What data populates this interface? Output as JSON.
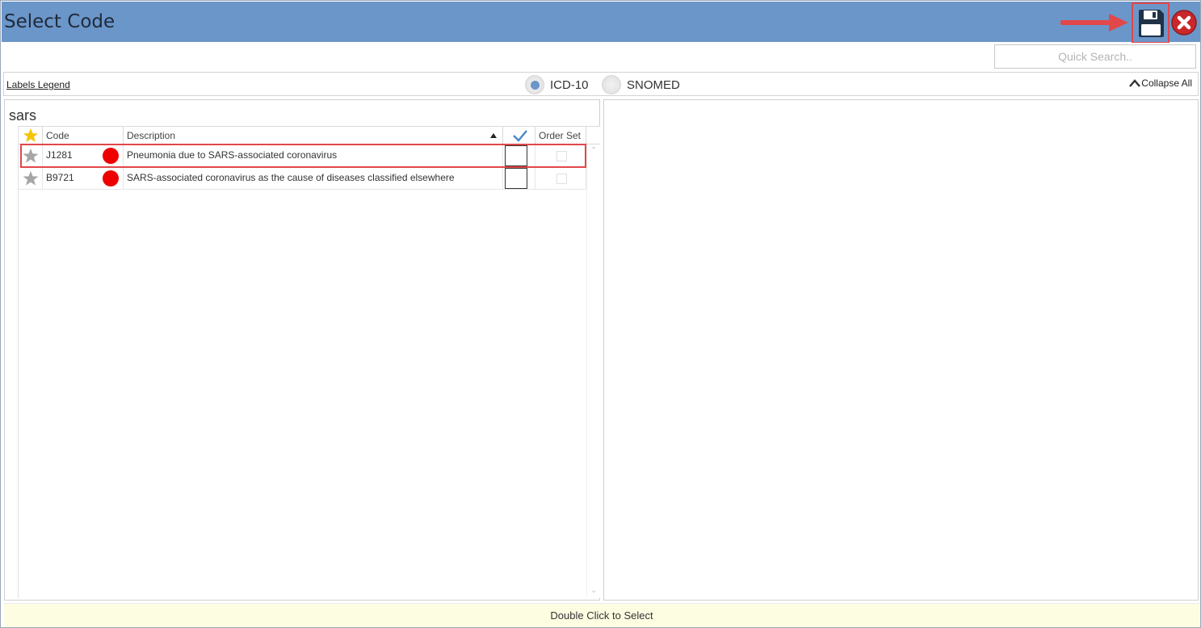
{
  "window": {
    "title": "Select Code"
  },
  "colors": {
    "titlebar": "#6b96c9",
    "highlight": "#e2474a",
    "status_dot": "#ee0000",
    "footer": "#fdfde2"
  },
  "icons": {
    "save": "floppy-disk-icon",
    "close": "close-icon",
    "arrow": "arrow-right-icon",
    "favorite": "star-icon",
    "selected": "checkmark-icon",
    "collapse": "chevron-up-icon"
  },
  "search": {
    "placeholder": "Quick Search..",
    "value": ""
  },
  "toolbar": {
    "legend_link": "Labels Legend",
    "code_systems": [
      {
        "label": "ICD-10",
        "selected": true
      },
      {
        "label": "SNOMED",
        "selected": false
      }
    ],
    "collapse_label": "Collapse All"
  },
  "results": {
    "search_term": "sars",
    "columns": {
      "code": "Code",
      "description": "Description",
      "order_set": "Order Set"
    },
    "rows": [
      {
        "code": "J1281",
        "description": "Pneumonia due to SARS-associated coronavirus",
        "favorite": false,
        "selected": false,
        "order_set": false
      },
      {
        "code": "B9721",
        "description": "SARS-associated coronavirus as the cause of diseases classified elsewhere",
        "favorite": false,
        "selected": false,
        "order_set": false
      }
    ]
  },
  "footer": {
    "hint": "Double Click to Select"
  }
}
